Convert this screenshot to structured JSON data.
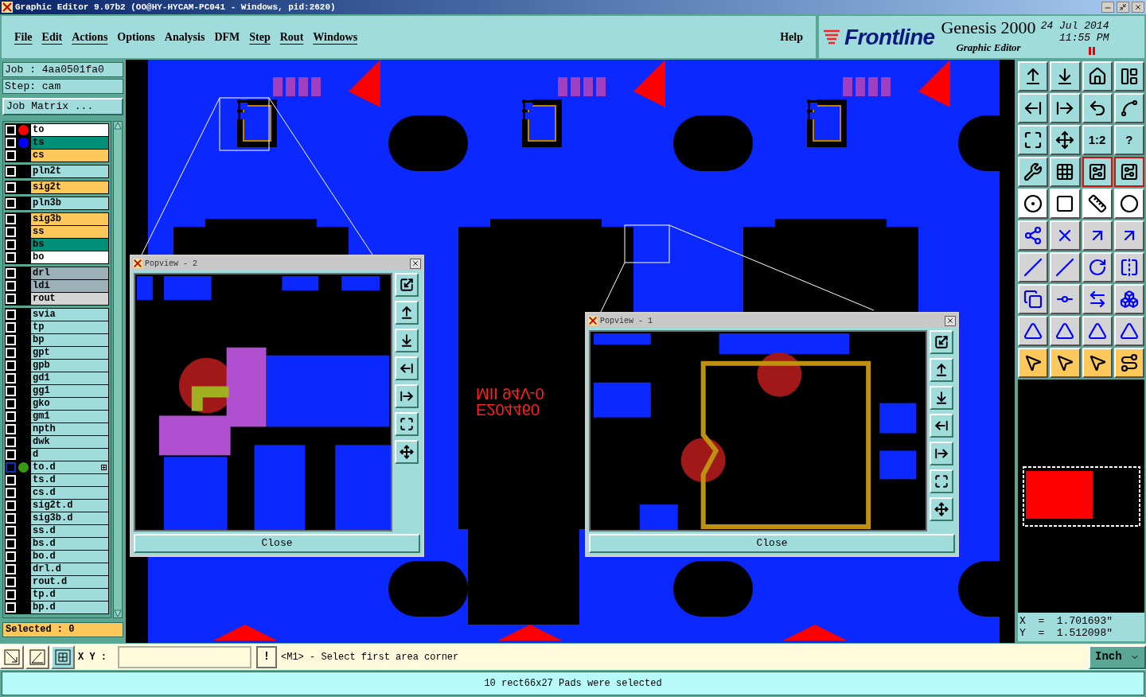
{
  "window": {
    "title": "Graphic Editor 9.07b2 (OO@HY-HYCAM-PC041 - Windows, pid:2620)"
  },
  "menu": [
    {
      "label": "File",
      "mnemonic": true
    },
    {
      "label": "Edit",
      "mnemonic": true
    },
    {
      "label": "Actions",
      "mnemonic": true
    },
    {
      "label": "Options",
      "mnemonic": false
    },
    {
      "label": "Analysis",
      "mnemonic": false
    },
    {
      "label": "DFM",
      "mnemonic": false
    },
    {
      "label": "Step",
      "mnemonic": true
    },
    {
      "label": "Rout",
      "mnemonic": true
    },
    {
      "label": "Windows",
      "mnemonic": true
    }
  ],
  "help": "Help",
  "brand": {
    "logo": "Frontline",
    "product": "Genesis 2000",
    "subtitle": "Graphic Editor",
    "date": "24 Jul 2014",
    "time": "11:55 PM"
  },
  "job": {
    "job": "Job : 4aa0501fa0",
    "step": "Step: cam",
    "matrix_button": "Job Matrix ..."
  },
  "layer_groups": [
    [
      {
        "name": "to",
        "color": "#ffffff",
        "marker": {
          "color": "#ff0000"
        },
        "checked": false,
        "work": false
      },
      {
        "name": "ts",
        "color": "#00907a",
        "marker": {
          "color": "#0000ff"
        },
        "checked": false,
        "work": false
      },
      {
        "name": "cs",
        "color": "#ffc85a",
        "checked": false,
        "work": false
      }
    ],
    [
      {
        "name": "pln2t",
        "color": "#a0dcdc",
        "checked": false,
        "work": false
      }
    ],
    [
      {
        "name": "sig2t",
        "color": "#ffc85a",
        "checked": false,
        "work": false
      }
    ],
    [
      {
        "name": "pln3b",
        "color": "#a0dcdc",
        "checked": false,
        "work": false
      }
    ],
    [
      {
        "name": "sig3b",
        "color": "#ffc85a",
        "checked": false,
        "work": false
      },
      {
        "name": "ss",
        "color": "#ffc85a",
        "checked": false,
        "work": false
      },
      {
        "name": "bs",
        "color": "#00907a",
        "checked": false,
        "work": false
      },
      {
        "name": "bo",
        "color": "#ffffff",
        "checked": false,
        "work": false
      }
    ],
    [
      {
        "name": "drl",
        "color": "#9cb0b8",
        "checked": false,
        "work": false
      },
      {
        "name": "ldi",
        "color": "#9cb0b8",
        "checked": false,
        "work": false
      },
      {
        "name": "rout",
        "color": "#d4d4d4",
        "checked": false,
        "work": false
      }
    ],
    [
      {
        "name": "svia",
        "color": "#a0dcdc",
        "checked": false,
        "work": false
      },
      {
        "name": "tp",
        "color": "#a0dcdc",
        "checked": false,
        "work": false
      },
      {
        "name": "bp",
        "color": "#a0dcdc",
        "checked": false,
        "work": false
      },
      {
        "name": "gpt",
        "color": "#a0dcdc",
        "checked": false,
        "work": false
      },
      {
        "name": "gpb",
        "color": "#a0dcdc",
        "checked": false,
        "work": false
      },
      {
        "name": "gd1",
        "color": "#a0dcdc",
        "checked": false,
        "work": false
      },
      {
        "name": "gg1",
        "color": "#a0dcdc",
        "checked": false,
        "work": false
      },
      {
        "name": "gko",
        "color": "#a0dcdc",
        "checked": false,
        "work": false
      },
      {
        "name": "gm1",
        "color": "#a0dcdc",
        "checked": false,
        "work": false
      },
      {
        "name": "npth",
        "color": "#a0dcdc",
        "checked": false,
        "work": false
      },
      {
        "name": "dwk",
        "color": "#a0dcdc",
        "checked": false,
        "work": false
      },
      {
        "name": "d",
        "color": "#a0dcdc",
        "checked": false,
        "work": false
      },
      {
        "name": "to.d",
        "color": "#a0dcdc",
        "marker": {
          "color": "#349c14"
        },
        "checked": false,
        "work": true
      },
      {
        "name": "ts.d",
        "color": "#a0dcdc",
        "checked": false,
        "work": false
      },
      {
        "name": "cs.d",
        "color": "#a0dcdc",
        "checked": false,
        "work": false
      },
      {
        "name": "sig2t.d",
        "color": "#a0dcdc",
        "checked": false,
        "work": false
      },
      {
        "name": "sig3b.d",
        "color": "#a0dcdc",
        "checked": false,
        "work": false
      },
      {
        "name": "ss.d",
        "color": "#a0dcdc",
        "checked": false,
        "work": false
      },
      {
        "name": "bs.d",
        "color": "#a0dcdc",
        "checked": false,
        "work": false
      },
      {
        "name": "bo.d",
        "color": "#a0dcdc",
        "checked": false,
        "work": false
      },
      {
        "name": "drl.d",
        "color": "#a0dcdc",
        "checked": false,
        "work": false
      },
      {
        "name": "rout.d",
        "color": "#a0dcdc",
        "checked": false,
        "work": false
      },
      {
        "name": "tp.d",
        "color": "#a0dcdc",
        "checked": false,
        "work": false
      },
      {
        "name": "bp.d",
        "color": "#a0dcdc",
        "checked": false,
        "work": false
      }
    ]
  ],
  "selected_count": "Selected : 0",
  "canvas": {
    "markings": [
      "MII 94V-0",
      "E204460"
    ]
  },
  "popviews": [
    {
      "title": "Popview - 2",
      "close": "Close",
      "kind": "corner"
    },
    {
      "title": "Popview - 1",
      "close": "Close",
      "kind": "outline"
    }
  ],
  "tool_groups": [
    {
      "kind": "view",
      "tools": [
        {
          "active": false
        },
        {
          "active": false
        },
        {
          "active": false
        },
        {
          "active": false
        },
        {
          "active": false
        },
        {
          "active": false
        },
        {
          "active": false
        },
        {
          "active": false
        },
        {
          "active": false
        },
        {
          "active": false
        },
        {
          "active": false,
          "label": "1:2"
        },
        {
          "active": false,
          "label": "?"
        },
        {
          "active": false
        },
        {
          "active": false
        },
        {
          "active": true
        },
        {
          "active": true
        }
      ]
    },
    {
      "kind": "display",
      "tools": [
        {
          "active": false
        },
        {
          "active": false
        },
        {
          "active": false
        },
        {
          "active": false
        }
      ]
    },
    {
      "kind": "edit",
      "tools": [
        {
          "active": false
        },
        {
          "active": false
        },
        {
          "active": false
        },
        {
          "active": false
        },
        {
          "active": false
        },
        {
          "active": false
        },
        {
          "active": false
        },
        {
          "active": false
        },
        {
          "active": false
        },
        {
          "active": false
        },
        {
          "active": false
        },
        {
          "active": false
        },
        {
          "active": false
        },
        {
          "active": false
        },
        {
          "active": false
        },
        {
          "active": false
        }
      ]
    },
    {
      "kind": "select",
      "tools": [
        {
          "active": false
        },
        {
          "active": false
        },
        {
          "active": false
        },
        {
          "active": false
        }
      ]
    }
  ],
  "coords": {
    "x": "X  =  1.701693\"",
    "y": "Y  =  1.512098\""
  },
  "command": {
    "xy_label": "X Y :",
    "bang": "!",
    "prompt": "<M1> - Select first area corner",
    "units": "Inch"
  },
  "status": "10 rect66x27 Pads were selected"
}
